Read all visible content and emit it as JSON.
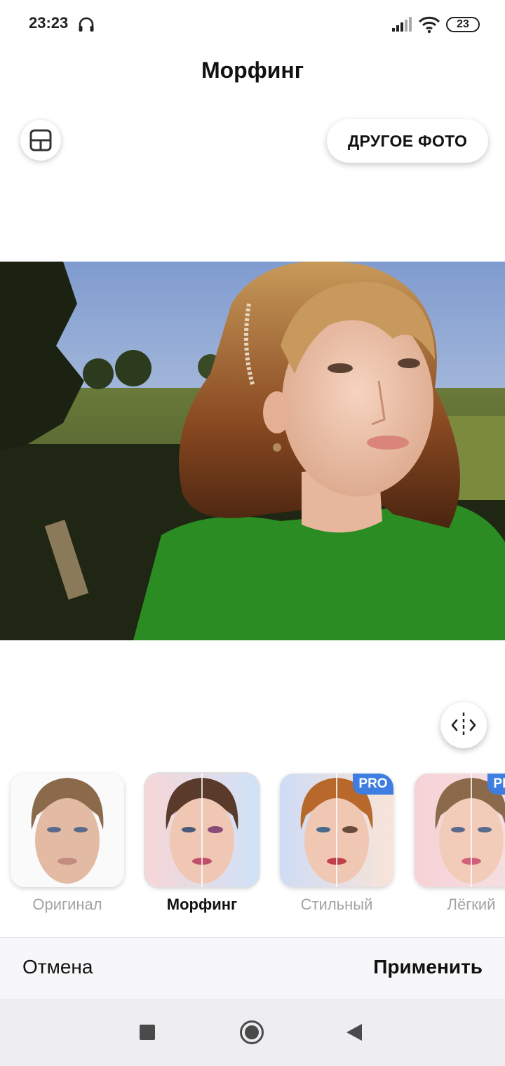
{
  "status_bar": {
    "time": "23:23",
    "battery": "23",
    "icons": [
      "headphones-icon",
      "signal-icon",
      "wifi-icon",
      "battery-icon"
    ]
  },
  "header": {
    "title": "Морфинг",
    "layout_icon": "layout-icon",
    "other_photo_label": "ДРУГОЕ ФОТО"
  },
  "photo": {
    "alt": "selfie-photo"
  },
  "compare_icon": "compare-split-icon",
  "filters": [
    {
      "label": "Оригинал",
      "selected": false,
      "pro": false
    },
    {
      "label": "Морфинг",
      "selected": true,
      "pro": false
    },
    {
      "label": "Стильный",
      "selected": false,
      "pro": true,
      "badge": "PRO"
    },
    {
      "label": "Лёгкий",
      "selected": false,
      "pro": true,
      "badge": "PRO"
    }
  ],
  "actions": {
    "cancel_label": "Отмена",
    "apply_label": "Применить"
  },
  "nav": {
    "icons": [
      "recents-icon",
      "home-icon",
      "back-icon"
    ]
  },
  "colors": {
    "accent": "#3d7ee0",
    "inactive_label": "#a3a3a3"
  }
}
